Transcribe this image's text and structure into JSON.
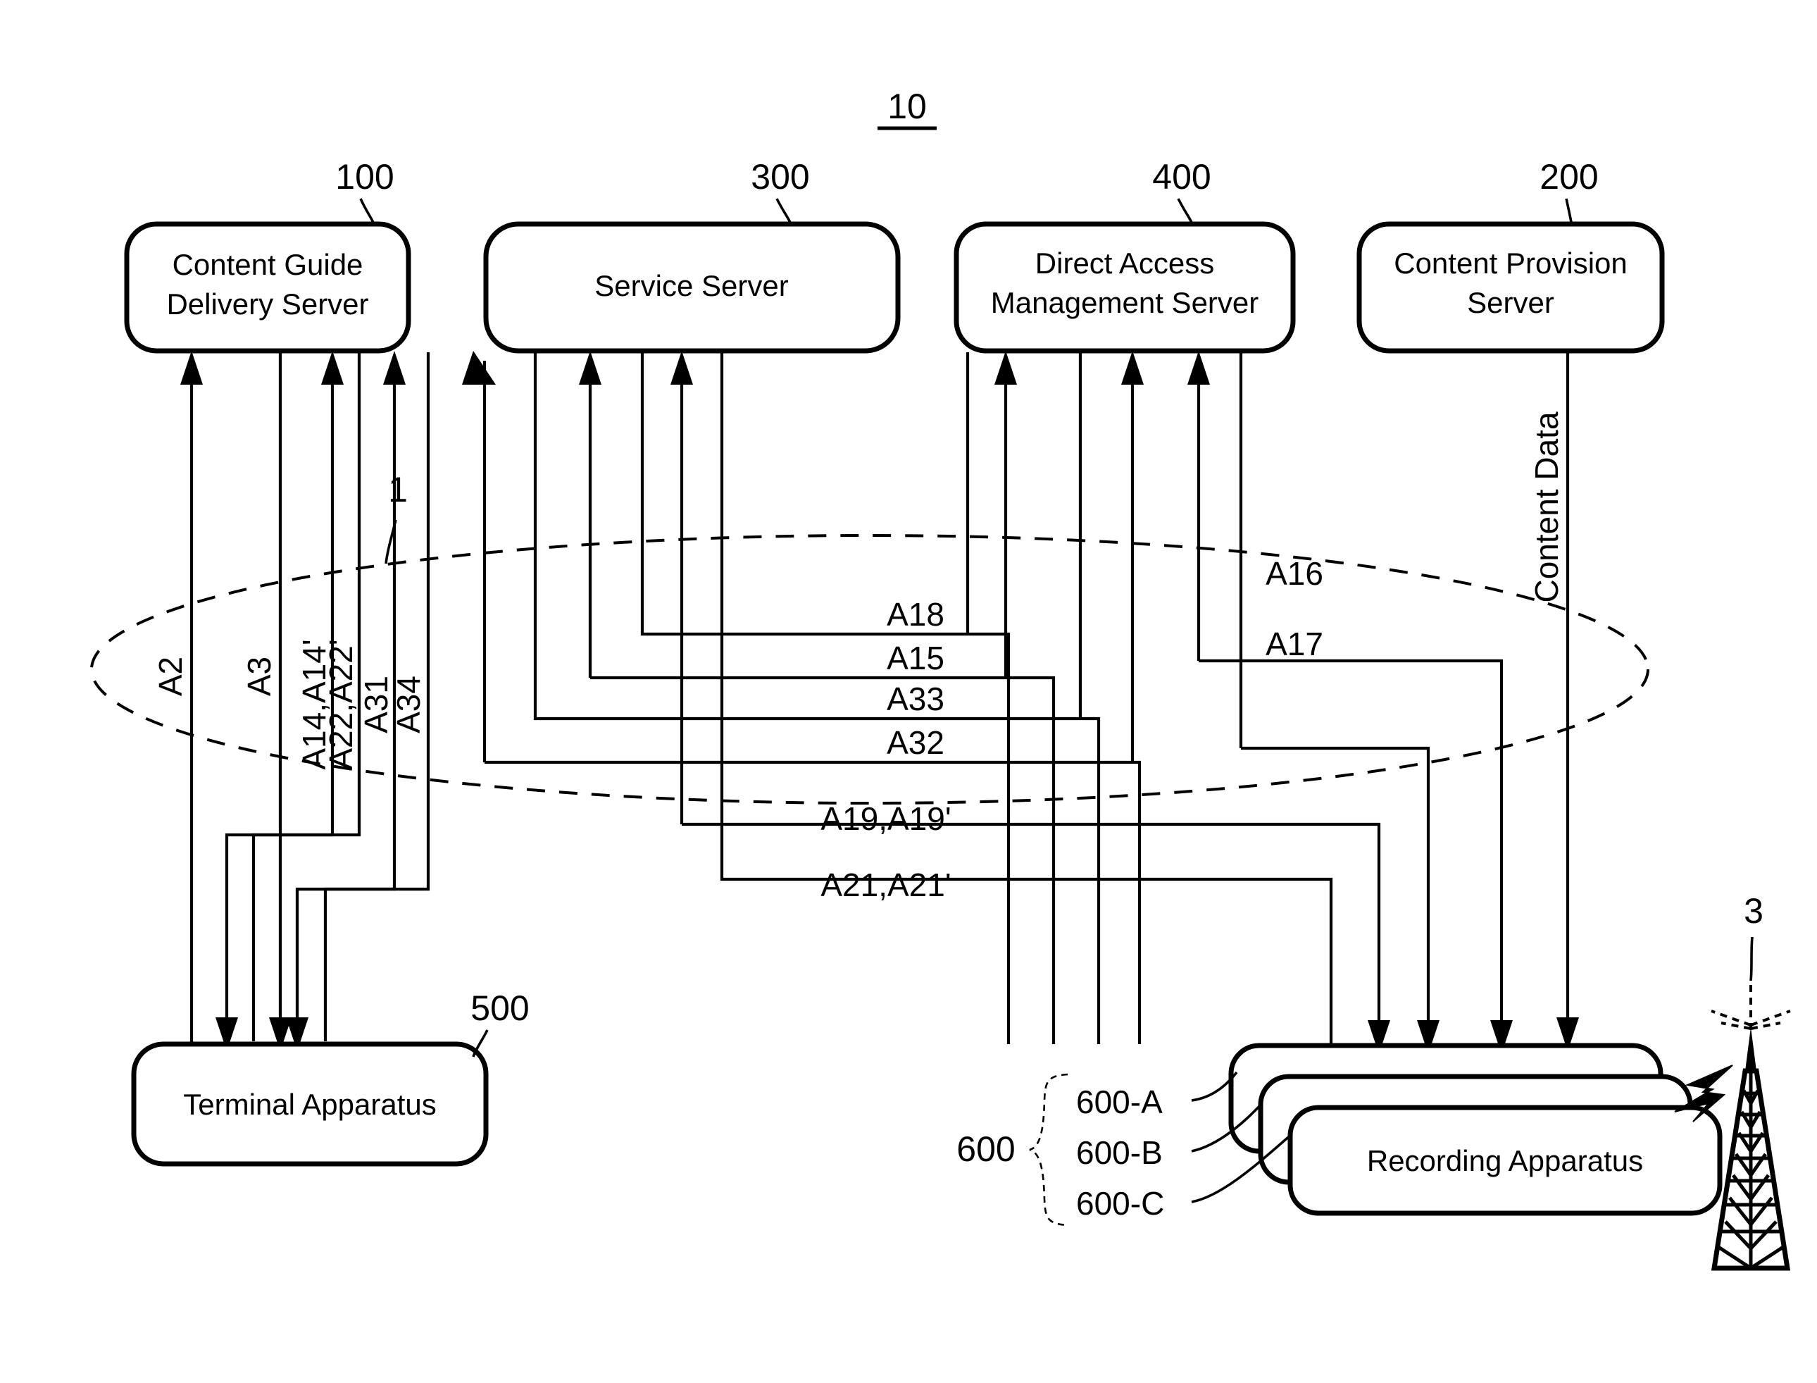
{
  "figure": {
    "id_label": "10",
    "network_cloud_label": "1",
    "broadcast_label": "3"
  },
  "nodes": [
    {
      "key": "content_guide_delivery_server",
      "ref": "100",
      "lines": [
        "Content Guide",
        "Delivery Server"
      ]
    },
    {
      "key": "service_server",
      "ref": "300",
      "lines": [
        "Service Server"
      ]
    },
    {
      "key": "direct_access_management_server",
      "ref": "400",
      "lines": [
        "Direct Access",
        "Management Server"
      ]
    },
    {
      "key": "content_provision_server",
      "ref": "200",
      "lines": [
        "Content Provision",
        "Server"
      ]
    },
    {
      "key": "terminal_apparatus",
      "ref": "500",
      "lines": [
        "Terminal Apparatus"
      ]
    },
    {
      "key": "recording_apparatus",
      "ref": "600",
      "lines": [
        "Recording Apparatus"
      ]
    }
  ],
  "recording_group": {
    "group_ref": "600",
    "members": [
      "600-A",
      "600-B",
      "600-C"
    ]
  },
  "signal_labels": {
    "a2": "A2",
    "a3": "A3",
    "a14": "A14,A14'",
    "a22": "A22,A22'",
    "a31": "A31",
    "a34": "A34",
    "a18": "A18",
    "a15": "A15",
    "a33": "A33",
    "a32": "A32",
    "a16": "A16",
    "a17": "A17",
    "a19": "A19,A19'",
    "a21": "A21,A21'",
    "content_data": "Content Data"
  },
  "colors": {
    "stroke": "#000000",
    "background": "#ffffff"
  }
}
